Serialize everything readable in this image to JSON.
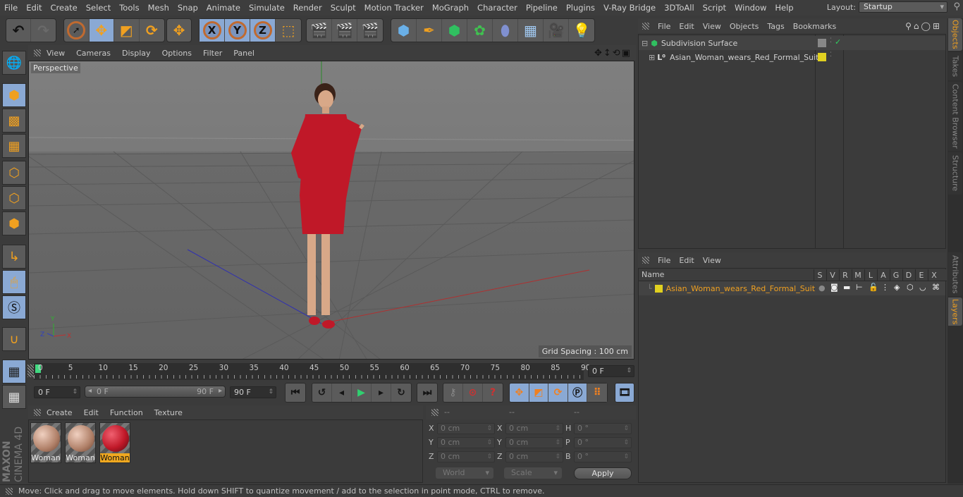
{
  "menubar": {
    "items": [
      "File",
      "Edit",
      "Create",
      "Select",
      "Tools",
      "Mesh",
      "Snap",
      "Animate",
      "Simulate",
      "Render",
      "Sculpt",
      "Motion Tracker",
      "MoGraph",
      "Character",
      "Pipeline",
      "Plugins",
      "V-Ray Bridge",
      "3DToAll",
      "Script",
      "Window",
      "Help"
    ],
    "layout_label": "Layout:",
    "layout_value": "Startup"
  },
  "toolbar": {
    "undo": "undo-icon",
    "redo": "redo-icon",
    "axis_x": "X",
    "axis_y": "Y",
    "axis_z": "Z"
  },
  "viewport": {
    "menu": [
      "View",
      "Cameras",
      "Display",
      "Options",
      "Filter",
      "Panel"
    ],
    "camera_label": "Perspective",
    "grid_spacing": "Grid Spacing : 100 cm",
    "axis_labels": {
      "x": "X",
      "y": "Y",
      "z": "Z"
    }
  },
  "timeline": {
    "ticks": [
      "0",
      "5",
      "10",
      "15",
      "20",
      "25",
      "30",
      "35",
      "40",
      "45",
      "50",
      "55",
      "60",
      "65",
      "70",
      "75",
      "80",
      "85",
      "90"
    ],
    "current_frame": "0 F",
    "start_frame": "0 F",
    "range_start": "0 F",
    "range_end": "90 F",
    "end_frame": "90 F"
  },
  "materials": {
    "menu": [
      "Create",
      "Edit",
      "Function",
      "Texture"
    ],
    "items": [
      {
        "name": "Woman",
        "selected": false,
        "color": "#c9a088"
      },
      {
        "name": "Woman",
        "selected": false,
        "color": "#c9a088"
      },
      {
        "name": "Woman",
        "selected": true,
        "color": "#c4202c"
      }
    ]
  },
  "coordinates": {
    "headers": [
      "--",
      "--",
      "--"
    ],
    "rows": [
      {
        "l1": "X",
        "v1": "0 cm",
        "l2": "X",
        "v2": "0 cm",
        "l3": "H",
        "v3": "0 °"
      },
      {
        "l1": "Y",
        "v1": "0 cm",
        "l2": "Y",
        "v2": "0 cm",
        "l3": "P",
        "v3": "0 °"
      },
      {
        "l1": "Z",
        "v1": "0 cm",
        "l2": "Z",
        "v2": "0 cm",
        "l3": "B",
        "v3": "0 °"
      }
    ],
    "space": "World",
    "mode": "Scale",
    "apply": "Apply"
  },
  "objects_panel": {
    "menu": [
      "File",
      "Edit",
      "View",
      "Objects",
      "Tags",
      "Bookmarks"
    ],
    "objects": [
      {
        "name": "Subdivision Surface",
        "icon": "subdivision-icon"
      },
      {
        "name": "Asian_Woman_wears_Red_Formal_Suit",
        "icon": "null-object-icon",
        "layer_color": "#e0d020"
      }
    ]
  },
  "layers_panel": {
    "menu": [
      "File",
      "Edit",
      "View"
    ],
    "columns": [
      "Name",
      "S",
      "V",
      "R",
      "M",
      "L",
      "A",
      "G",
      "D",
      "E",
      "X"
    ],
    "layers": [
      {
        "name": "Asian_Woman_wears_Red_Formal_Suit",
        "color": "#e0d020",
        "text_color": "#f0a020"
      }
    ]
  },
  "right_tabs": {
    "top": [
      "Objects",
      "Takes",
      "Content Browser",
      "Structure"
    ],
    "bottom": [
      "Attributes",
      "Layers"
    ]
  },
  "status": "Move: Click and drag to move elements. Hold down SHIFT to quantize movement / add to the selection in point mode, CTRL to remove.",
  "brand": {
    "maker": "MAXON",
    "product": "CINEMA 4D"
  }
}
